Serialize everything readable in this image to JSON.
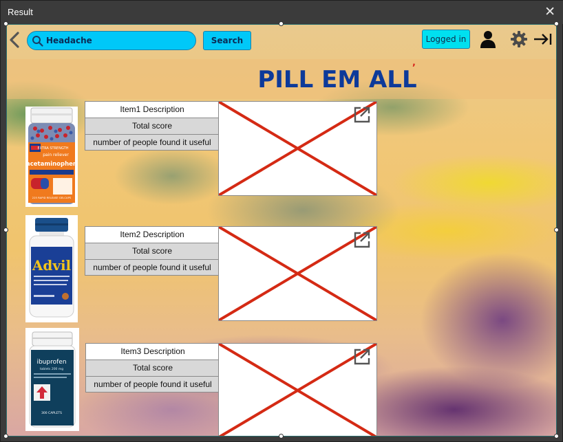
{
  "window": {
    "title": "Result",
    "close_glyph": "✕"
  },
  "toolbar": {
    "back_icon": "chevron-left-icon",
    "search": {
      "value": "Headache",
      "icon": "search-icon"
    },
    "search_button": "Search",
    "login_status": "Logged in",
    "user_icon": "user-icon",
    "settings_icon": "gear-icon",
    "logout_icon": "logout-arrow-icon"
  },
  "header": {
    "app_title": "PILL EM ALL",
    "title_mark": ","
  },
  "colors": {
    "accent": "#00c8f8",
    "title": "#0d3a9a",
    "placeholder_cross": "#d42a14"
  },
  "results": [
    {
      "description": "Item1 Description",
      "score_label": "Total score",
      "useful_label": "number of people found it useful",
      "product_name": "acetaminophen",
      "product_subtitle": "pain reliever",
      "product_top_note": "EXTRA STRENGTH",
      "product_bottom_note": "225 RAPID RELEASE GELCAPS",
      "open_icon": "open-external-icon"
    },
    {
      "description": "Item2 Description",
      "score_label": "Total score",
      "useful_label": "number of people found it useful",
      "product_name": "Advil",
      "open_icon": "open-external-icon"
    },
    {
      "description": "Item3 Description",
      "score_label": "Total score",
      "useful_label": "number of people found it useful",
      "product_name": "ibuprofen",
      "product_subtitle": "tablets 200 mg",
      "product_count": "300 CAPLETS",
      "open_icon": "open-external-icon"
    }
  ]
}
